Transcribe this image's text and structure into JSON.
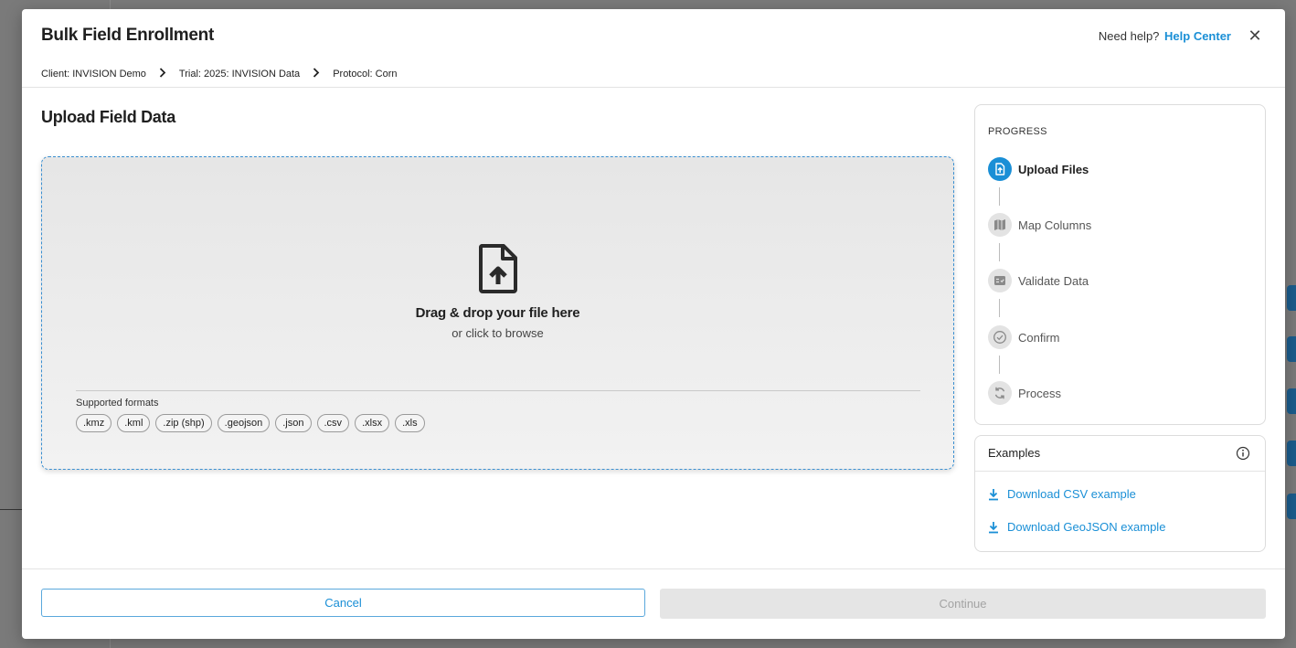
{
  "modal": {
    "title": "Bulk Field Enrollment",
    "help_prefix": "Need help?",
    "help_link": "Help Center",
    "close_symbol": "✕"
  },
  "breadcrumb": [
    "Client: INVISION Demo",
    "Trial: 2025: INVISION Data",
    "Protocol: Corn"
  ],
  "upload": {
    "section_title": "Upload Field Data",
    "drop_main": "Drag & drop your file here",
    "drop_sub": "or click to browse",
    "formats_label": "Supported formats",
    "formats": [
      ".kmz",
      ".kml",
      ".zip (shp)",
      ".geojson",
      ".json",
      ".csv",
      ".xlsx",
      ".xls"
    ]
  },
  "progress": {
    "label": "PROGRESS",
    "steps": [
      {
        "label": "Upload Files",
        "icon": "file-upload-icon",
        "active": true
      },
      {
        "label": "Map Columns",
        "icon": "map-icon",
        "active": false
      },
      {
        "label": "Validate Data",
        "icon": "checklist-icon",
        "active": false
      },
      {
        "label": "Confirm",
        "icon": "check-circle-icon",
        "active": false
      },
      {
        "label": "Process",
        "icon": "refresh-icon",
        "active": false
      }
    ]
  },
  "examples": {
    "title": "Examples",
    "links": [
      "Download CSV example",
      "Download GeoJSON example"
    ]
  },
  "footer": {
    "cancel_label": "Cancel",
    "continue_label": "Continue"
  },
  "colors": {
    "accent": "#1a8fd6",
    "disabled_bg": "#e5e5e5",
    "disabled_text": "#a3a3a3"
  }
}
